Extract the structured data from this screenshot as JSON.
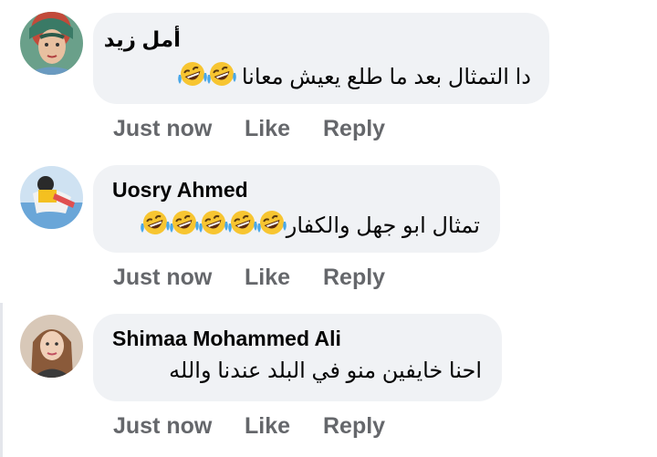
{
  "comments": [
    {
      "author": "أمل زيد",
      "text": "دا التمثال بعد ما طلع يعيش معانا",
      "emoji_count": 2,
      "emoji": "rolling-on-floor-laughing",
      "time": "Just now",
      "like": "Like",
      "reply": "Reply"
    },
    {
      "author": "Uosry Ahmed",
      "text": "تمثال ابو جهل والكفار",
      "emoji_count": 5,
      "emoji": "rolling-on-floor-laughing",
      "time": "Just now",
      "like": "Like",
      "reply": "Reply"
    },
    {
      "author": "Shimaa Mohammed Ali",
      "text": "احنا خايفين منو في البلد عندنا والله",
      "emoji_count": 0,
      "time": "Just now",
      "like": "Like",
      "reply": "Reply"
    }
  ],
  "colors": {
    "bubble": "#f0f2f5",
    "meta": "#65676b",
    "text": "#050505"
  }
}
